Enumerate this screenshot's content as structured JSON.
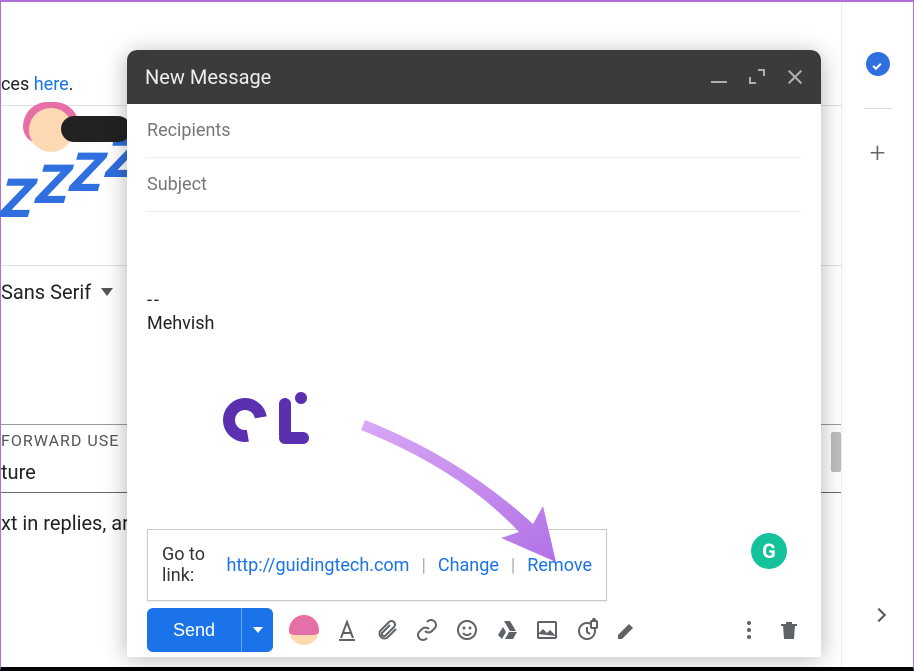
{
  "background": {
    "line1_prefix": "ces ",
    "line1_link": "here",
    "line1_suffix": ".",
    "font_name": "Sans Serif",
    "section_label": "FORWARD USE",
    "section_value": "ture",
    "note": "xt in replies, ar"
  },
  "compose": {
    "title": "New Message",
    "recipients_label": "Recipients",
    "subject_label": "Subject",
    "signature_dashes": "--",
    "signature_name": "Mehvish"
  },
  "link_popup": {
    "label": "Go to link:",
    "url": "http://guidingtech.com",
    "change": "Change",
    "remove": "Remove",
    "separator": "|"
  },
  "toolbar": {
    "send": "Send"
  },
  "grammarly_letter": "G"
}
